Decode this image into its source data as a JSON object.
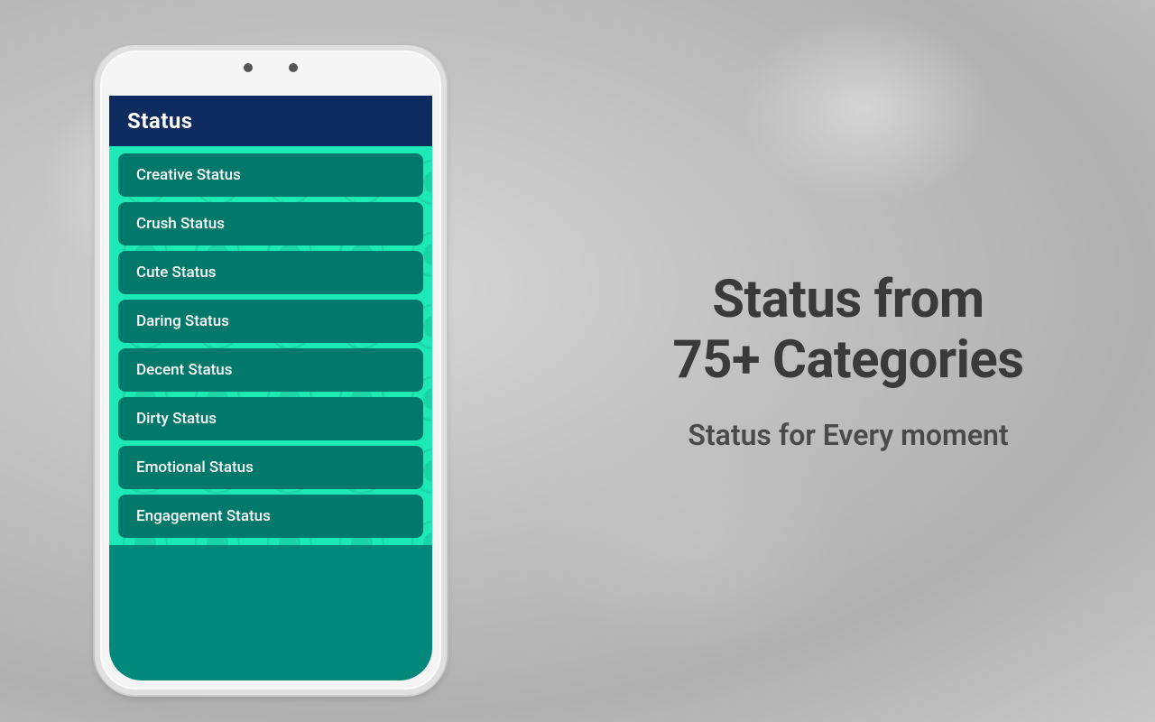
{
  "app": {
    "header": "Status",
    "list_items": [
      "Creative Status",
      "Crush Status",
      "Cute Status",
      "Daring Status",
      "Decent Status",
      "Dirty Status",
      "Emotional Status",
      "Engagement Status"
    ]
  },
  "right": {
    "headline": "Status from\n75+ Categories",
    "subheadline": "Status for Every moment"
  },
  "colors": {
    "header_bg": "#0d2b5e",
    "list_bg": "#1de9b6",
    "item_bg": "#00796b",
    "phone_bg": "#f5f5f5"
  }
}
